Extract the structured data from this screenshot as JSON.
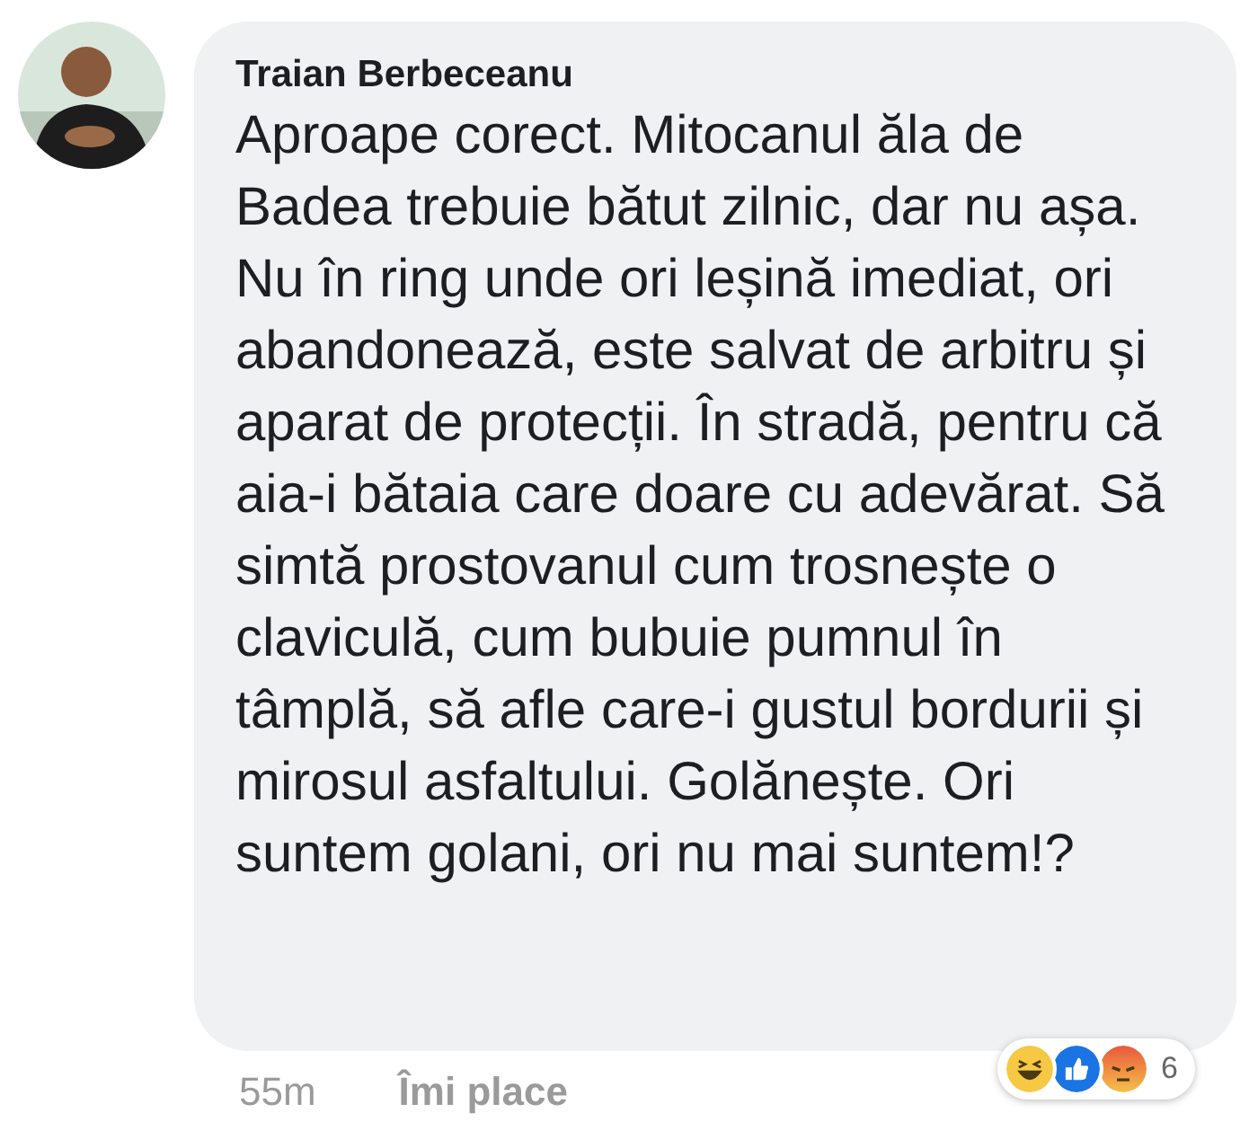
{
  "comment": {
    "author": "Traian Berbeceanu",
    "text": "Aproape corect. Mitocanul ăla de Badea trebuie bătut zilnic, dar nu așa. Nu în ring unde ori leșină imediat, ori abandonează, este salvat de arbitru și aparat de protecții. În stradă, pentru că aia-i bătaia care doare cu adevărat. Să simtă prostovanul cum trosnește o claviculă, cum bubuie pumnul în tâmplă, să afle care-i gustul bordurii și mirosul asfaltului. Golănește. Ori suntem golani, ori nu mai suntem!?",
    "time": "55m",
    "like_action": "Îmi place",
    "reactions": {
      "items": [
        {
          "kind": "haha"
        },
        {
          "kind": "like"
        },
        {
          "kind": "angry"
        }
      ],
      "count": "6"
    }
  }
}
